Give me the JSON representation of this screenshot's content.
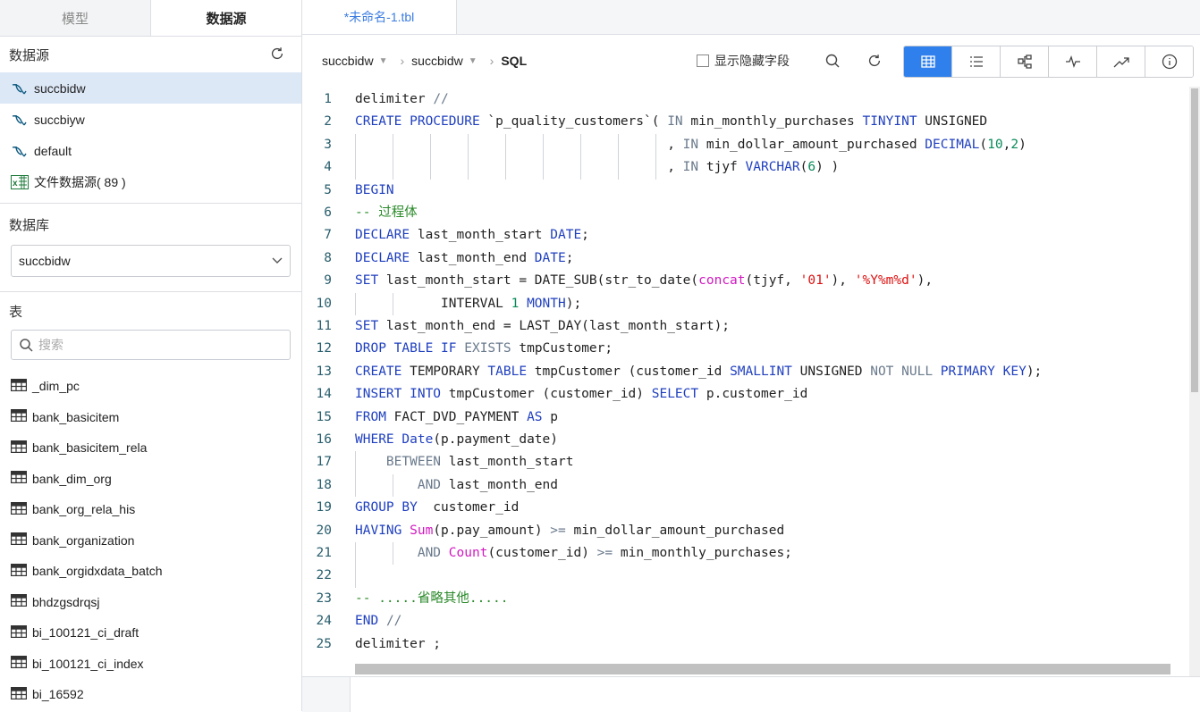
{
  "left_tabs": {
    "model": "模型",
    "datasource": "数据源"
  },
  "datasource_section": {
    "title": "数据源",
    "items": [
      {
        "label": "succbidw",
        "icon": "mysql-icon"
      },
      {
        "label": "succbiyw",
        "icon": "mysql-icon"
      },
      {
        "label": "default",
        "icon": "mysql-icon"
      },
      {
        "label": "文件数据源( 89 )",
        "icon": "excel-icon"
      }
    ]
  },
  "database_section": {
    "title": "数据库",
    "selected": "succbidw"
  },
  "table_section": {
    "title": "表",
    "search_placeholder": "搜索",
    "tables": [
      "_dim_pc",
      "bank_basicitem",
      "bank_basicitem_rela",
      "bank_dim_org",
      "bank_org_rela_his",
      "bank_organization",
      "bank_orgidxdata_batch",
      "bhdzgsdrqsj",
      "bi_100121_ci_draft",
      "bi_100121_ci_index",
      "bi_16592"
    ]
  },
  "editor_tab": "*未命名-1.tbl",
  "breadcrumb": {
    "db1": "succbidw",
    "db2": "succbidw",
    "mode": "SQL"
  },
  "show_hidden_fields": "显示隐藏字段",
  "colors": {
    "accent": "#2f80ed",
    "keyword": "#1f3fbf",
    "comment": "#2a8a2a",
    "string": "#dd1111",
    "function": "#d118c0"
  },
  "code_lines": [
    {
      "n": "1",
      "html": "delimiter <span class='g'>//</span>"
    },
    {
      "n": "2",
      "html": "<span class='k'>CREATE PROCEDURE</span> `p_quality_customers`( <span class='g'>IN</span> min_monthly_purchases <span class='k'>TINYINT</span> UNSIGNED"
    },
    {
      "n": "3",
      "html": "                                        , <span class='g'>IN</span> min_dollar_amount_purchased <span class='k'>DECIMAL</span>(<span class='n'>10</span>,<span class='n'>2</span>)"
    },
    {
      "n": "4",
      "html": "                                        , <span class='g'>IN</span> tjyf <span class='k'>VARCHAR</span>(<span class='n'>6</span>) )"
    },
    {
      "n": "5",
      "html": "<span class='k'>BEGIN</span>"
    },
    {
      "n": "6",
      "html": "<span class='c'>-- 过程体</span>"
    },
    {
      "n": "7",
      "html": "<span class='k'>DECLARE</span> last_month_start <span class='k'>DATE</span>;"
    },
    {
      "n": "8",
      "html": "<span class='k'>DECLARE</span> last_month_end <span class='k'>DATE</span>;"
    },
    {
      "n": "9",
      "html": "<span class='k'>SET</span> last_month_start = DATE_SUB(str_to_date(<span class='f'>concat</span>(tjyf, <span class='s'>'01'</span>), <span class='s'>'%Y%m%d'</span>),"
    },
    {
      "n": "10",
      "html": "           INTERVAL <span class='n'>1</span> <span class='k'>MONTH</span>);"
    },
    {
      "n": "11",
      "html": "<span class='k'>SET</span> last_month_end = LAST_DAY(last_month_start);"
    },
    {
      "n": "12",
      "html": "<span class='k'>DROP TABLE IF</span> <span class='g'>EXISTS</span> tmpCustomer;"
    },
    {
      "n": "13",
      "html": "<span class='k'>CREATE</span> TEMPORARY <span class='k'>TABLE</span> tmpCustomer (customer_id <span class='k'>SMALLINT</span> UNSIGNED <span class='g'>NOT NULL</span> <span class='k'>PRIMARY KEY</span>);"
    },
    {
      "n": "14",
      "html": "<span class='k'>INSERT INTO</span> tmpCustomer (customer_id) <span class='k'>SELECT</span> p.customer_id"
    },
    {
      "n": "15",
      "html": "<span class='k'>FROM</span> FACT_DVD_PAYMENT <span class='k'>AS</span> p"
    },
    {
      "n": "16",
      "html": "<span class='k'>WHERE</span> <span class='k'>Date</span>(p.payment_date)"
    },
    {
      "n": "17",
      "html": "    <span class='g'>BETWEEN</span> last_month_start"
    },
    {
      "n": "18",
      "html": "        <span class='g'>AND</span> last_month_end"
    },
    {
      "n": "19",
      "html": "<span class='k'>GROUP BY</span>  customer_id"
    },
    {
      "n": "20",
      "html": "<span class='k'>HAVING</span> <span class='f'>Sum</span>(p.pay_amount) <span class='g'>&gt;=</span> min_dollar_amount_purchased"
    },
    {
      "n": "21",
      "html": "        <span class='g'>AND</span> <span class='f'>Count</span>(customer_id) <span class='g'>&gt;=</span> min_monthly_purchases;"
    },
    {
      "n": "22",
      "html": ""
    },
    {
      "n": "23",
      "html": "<span class='c'>-- .....省略其他.....</span>"
    },
    {
      "n": "24",
      "html": "<span class='k'>END</span> <span class='g'>//</span>"
    },
    {
      "n": "25",
      "html": "delimiter ;"
    }
  ]
}
